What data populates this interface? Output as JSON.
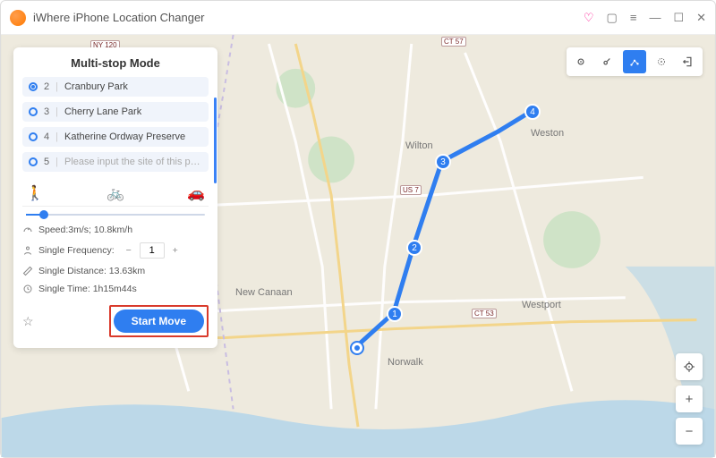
{
  "app": {
    "title": "iWhere iPhone Location Changer"
  },
  "panel": {
    "title": "Multi-stop Mode",
    "stops": [
      {
        "num": "2",
        "label": "Cranbury Park",
        "selected": true
      },
      {
        "num": "3",
        "label": "Cherry Lane Park",
        "selected": false
      },
      {
        "num": "4",
        "label": "Katherine Ordway Preserve",
        "selected": false
      },
      {
        "num": "5",
        "label": "Please input the site of this path",
        "selected": false,
        "placeholder": true
      }
    ],
    "speed_text": "Speed:3m/s; 10.8km/h",
    "frequency_label": "Single Frequency:",
    "frequency_value": "1",
    "distance_text": "Single Distance: 13.63km",
    "time_text": "Single Time: 1h15m44s",
    "start_label": "Start Move"
  },
  "map": {
    "labels": {
      "wilton": "Wilton",
      "weston": "Weston",
      "westport": "Westport",
      "norwalk": "Norwalk",
      "new_canaan": "New Canaan",
      "ny120": "NY 120",
      "us7": "US 7",
      "ct57": "CT 57",
      "ct53": "CT 53"
    },
    "route_nodes": [
      "1",
      "2",
      "3",
      "4"
    ]
  },
  "colors": {
    "primary": "#2f7ef0",
    "highlight": "#d93a2b"
  }
}
